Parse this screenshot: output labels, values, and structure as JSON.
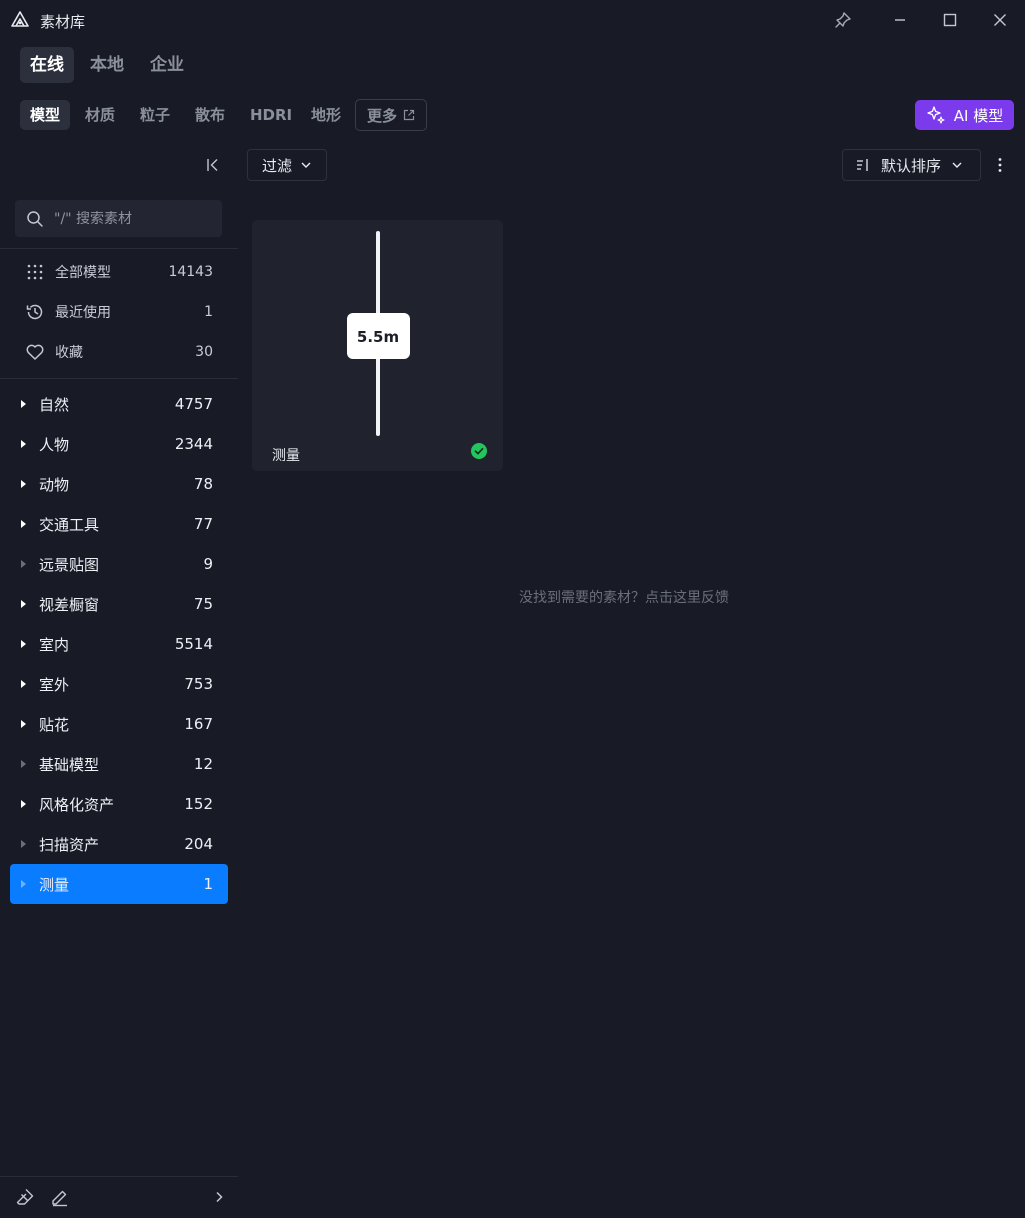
{
  "app": {
    "title": "素材库"
  },
  "source_tabs": [
    {
      "label": "在线",
      "active": true
    },
    {
      "label": "本地",
      "active": false
    },
    {
      "label": "企业",
      "active": false
    }
  ],
  "category_tabs": [
    {
      "label": "模型",
      "active": true
    },
    {
      "label": "材质",
      "active": false
    },
    {
      "label": "粒子",
      "active": false
    },
    {
      "label": "散布",
      "active": false
    },
    {
      "label": "HDRI",
      "active": false
    },
    {
      "label": "地形",
      "active": false
    }
  ],
  "more_tab": {
    "label": "更多",
    "icon": "external-link-icon"
  },
  "ai_button": {
    "label": "AI 模型",
    "icon": "sparkle-icon",
    "color": "#7c3aed"
  },
  "search": {
    "placeholder": "\"/\" 搜索素材"
  },
  "quick_items": [
    {
      "label": "全部模型",
      "count": "14143",
      "icon": "grid-dots-icon"
    },
    {
      "label": "最近使用",
      "count": "1",
      "icon": "history-icon"
    },
    {
      "label": "收藏",
      "count": "30",
      "icon": "heart-icon"
    }
  ],
  "categories": [
    {
      "label": "自然",
      "count": "4757",
      "expandable": true
    },
    {
      "label": "人物",
      "count": "2344",
      "expandable": true
    },
    {
      "label": "动物",
      "count": "78",
      "expandable": true
    },
    {
      "label": "交通工具",
      "count": "77",
      "expandable": true
    },
    {
      "label": "远景贴图",
      "count": "9",
      "expandable": false
    },
    {
      "label": "视差橱窗",
      "count": "75",
      "expandable": true
    },
    {
      "label": "室内",
      "count": "5514",
      "expandable": true
    },
    {
      "label": "室外",
      "count": "753",
      "expandable": true
    },
    {
      "label": "贴花",
      "count": "167",
      "expandable": true
    },
    {
      "label": "基础模型",
      "count": "12",
      "expandable": false
    },
    {
      "label": "风格化资产",
      "count": "152",
      "expandable": true
    },
    {
      "label": "扫描资产",
      "count": "204",
      "expandable": false
    },
    {
      "label": "测量",
      "count": "1",
      "expandable": false,
      "selected": true
    }
  ],
  "toolbar": {
    "filter_label": "过滤",
    "sort_label": "默认排序"
  },
  "asset": {
    "name": "测量",
    "thumb_label": "5.5m",
    "downloaded": true
  },
  "empty_hint": "没找到需要的素材？点击这里反馈",
  "colors": {
    "background": "#181b26",
    "selected": "#0a7cff",
    "accent_ai": "#7c3aed",
    "success": "#22c55e"
  }
}
